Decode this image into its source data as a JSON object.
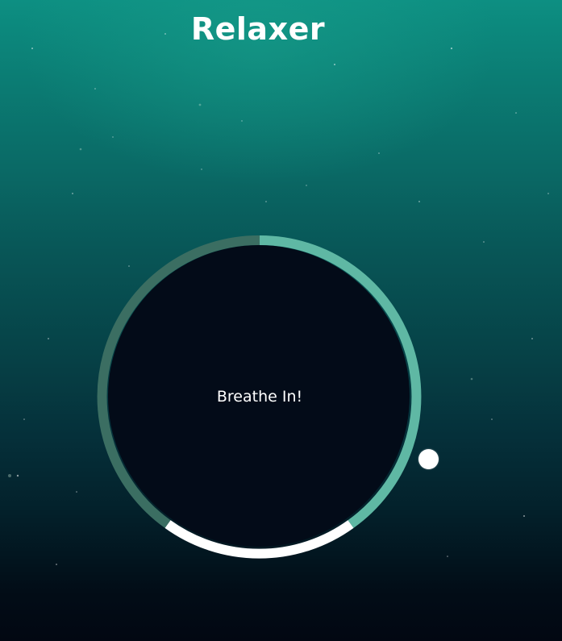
{
  "app": {
    "title": "Relaxer"
  },
  "breathing": {
    "instruction": "Breathe In!"
  },
  "colors": {
    "background_top": "#0d8f82",
    "background_bottom": "#020712",
    "inner_circle": "#030b18",
    "ring_inhale": "#5fb8a4",
    "ring_hold": "#ffffff",
    "ring_exhale": "#3b6e62",
    "pointer": "#ffffff"
  },
  "icons": {
    "pointer": "pointer-dot"
  }
}
